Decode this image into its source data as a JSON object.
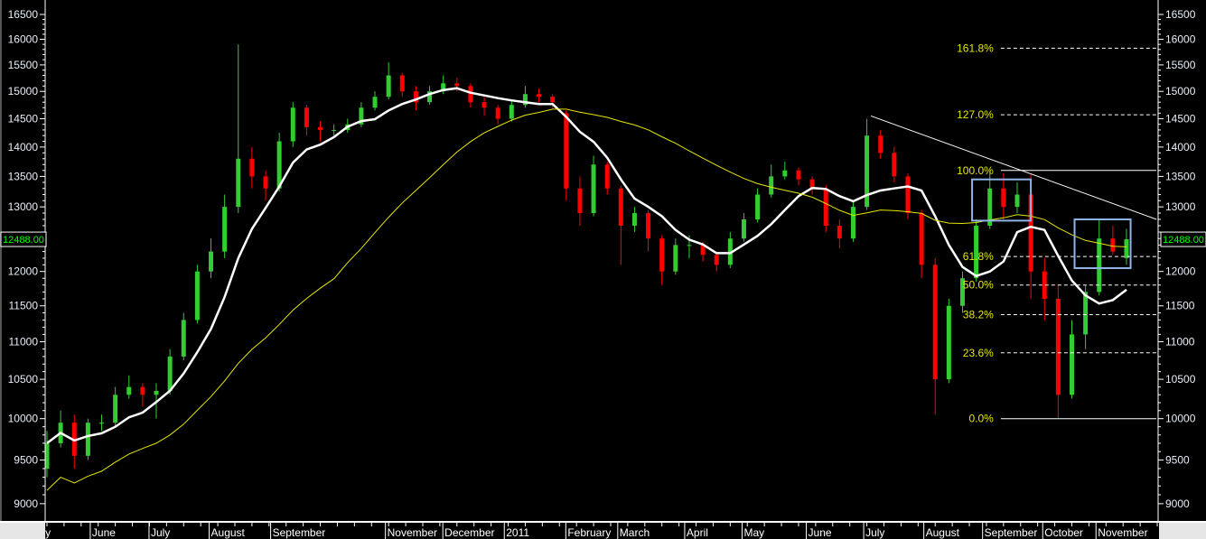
{
  "chart_data": {
    "type": "candlestick",
    "title": "",
    "ylim": [
      9000,
      16500
    ],
    "yscale": "log",
    "y_ticks": [
      16500,
      16000,
      15500,
      15000,
      14500,
      14000,
      13500,
      13000,
      12500,
      12000,
      11500,
      11000,
      10500,
      10000,
      9500,
      9000
    ],
    "last_price_label": "12488.00",
    "last_price": 12488,
    "month_labels": [
      {
        "label": "May",
        "at": -0.3
      },
      {
        "label": "June",
        "at": 3.3
      },
      {
        "label": "July",
        "at": 7.6
      },
      {
        "label": "August",
        "at": 12.0
      },
      {
        "label": "September",
        "at": 16.5
      },
      {
        "label": "November",
        "at": 24.9
      },
      {
        "label": "December",
        "at": 29.1
      },
      {
        "label": "2011",
        "at": 33.6
      },
      {
        "label": "February",
        "at": 38.1
      },
      {
        "label": "March",
        "at": 41.9
      },
      {
        "label": "April",
        "at": 46.8
      },
      {
        "label": "May",
        "at": 51.0
      },
      {
        "label": "June",
        "at": 55.7
      },
      {
        "label": "July",
        "at": 59.9
      },
      {
        "label": "August",
        "at": 64.3
      },
      {
        "label": "September",
        "at": 68.6
      },
      {
        "label": "October",
        "at": 73.0
      },
      {
        "label": "November",
        "at": 76.9
      }
    ],
    "candles": [
      [
        9400,
        9850,
        9300,
        9700
      ],
      [
        9700,
        10100,
        9650,
        9950
      ],
      [
        9950,
        10050,
        9400,
        9550
      ],
      [
        9550,
        10000,
        9500,
        9950
      ],
      [
        9950,
        10050,
        9850,
        9950
      ],
      [
        9950,
        10400,
        9900,
        10300
      ],
      [
        10300,
        10550,
        10250,
        10400
      ],
      [
        10400,
        10450,
        10150,
        10300
      ],
      [
        10300,
        10450,
        10000,
        10350
      ],
      [
        10350,
        10900,
        10300,
        10800
      ],
      [
        10800,
        11400,
        10750,
        11300
      ],
      [
        11300,
        12100,
        11250,
        12000
      ],
      [
        12000,
        12500,
        11900,
        12300
      ],
      [
        12300,
        13200,
        12200,
        13000
      ],
      [
        13000,
        15900,
        12900,
        13800
      ],
      [
        13800,
        14000,
        13300,
        13500
      ],
      [
        13500,
        13600,
        13100,
        13300
      ],
      [
        13300,
        14250,
        13250,
        14100
      ],
      [
        14100,
        14800,
        14000,
        14700
      ],
      [
        14700,
        14750,
        14200,
        14350
      ],
      [
        14350,
        14450,
        14100,
        14300
      ],
      [
        14300,
        14400,
        14200,
        14300
      ],
      [
        14300,
        14500,
        14250,
        14400
      ],
      [
        14400,
        14800,
        14350,
        14700
      ],
      [
        14700,
        15000,
        14650,
        14900
      ],
      [
        14900,
        15550,
        14850,
        15300
      ],
      [
        15300,
        15350,
        14900,
        15000
      ],
      [
        15000,
        15100,
        14650,
        14800
      ],
      [
        14800,
        15100,
        14750,
        15000
      ],
      [
        15000,
        15300,
        14950,
        15150
      ],
      [
        15150,
        15250,
        15000,
        15100
      ],
      [
        15100,
        15150,
        14700,
        14800
      ],
      [
        14800,
        14900,
        14550,
        14700
      ],
      [
        14700,
        14750,
        14400,
        14500
      ],
      [
        14500,
        14850,
        14450,
        14750
      ],
      [
        14750,
        15100,
        14700,
        14950
      ],
      [
        14950,
        15050,
        14800,
        14900
      ],
      [
        14900,
        14950,
        14700,
        14800
      ],
      [
        14600,
        14650,
        13100,
        13300
      ],
      [
        13300,
        13500,
        12700,
        12900
      ],
      [
        12900,
        13850,
        12850,
        13700
      ],
      [
        13700,
        13750,
        13200,
        13300
      ],
      [
        13300,
        13350,
        12100,
        12700
      ],
      [
        12700,
        13000,
        12600,
        12900
      ],
      [
        12900,
        12950,
        12300,
        12500
      ],
      [
        12500,
        12550,
        11800,
        12000
      ],
      [
        12000,
        12500,
        11950,
        12400
      ],
      [
        12400,
        12550,
        12200,
        12400
      ],
      [
        12400,
        12450,
        12150,
        12250
      ],
      [
        12250,
        12300,
        12000,
        12100
      ],
      [
        12100,
        12600,
        12050,
        12500
      ],
      [
        12500,
        12900,
        12450,
        12800
      ],
      [
        12800,
        13300,
        12750,
        13200
      ],
      [
        13200,
        13700,
        13150,
        13500
      ],
      [
        13500,
        13750,
        13450,
        13600
      ],
      [
        13600,
        13650,
        13350,
        13450
      ],
      [
        13450,
        13500,
        13200,
        13300
      ],
      [
        13300,
        13350,
        12600,
        12700
      ],
      [
        12700,
        12800,
        12350,
        12500
      ],
      [
        12500,
        13100,
        12450,
        13000
      ],
      [
        13000,
        14500,
        12950,
        14200
      ],
      [
        14200,
        14300,
        13800,
        13900
      ],
      [
        13900,
        14000,
        13400,
        13500
      ],
      [
        13500,
        13550,
        12800,
        12900
      ],
      [
        12900,
        12950,
        11900,
        12100
      ],
      [
        12100,
        12200,
        10050,
        10500
      ],
      [
        10500,
        11600,
        10450,
        11500
      ],
      [
        11500,
        12000,
        11400,
        11900
      ],
      [
        11900,
        12800,
        11850,
        12700
      ],
      [
        12700,
        13600,
        12650,
        13300
      ],
      [
        13300,
        13550,
        12800,
        13000
      ],
      [
        13000,
        13400,
        12900,
        13200
      ],
      [
        13200,
        13550,
        11600,
        12000
      ],
      [
        12000,
        12200,
        11300,
        11600
      ],
      [
        11600,
        11800,
        10000,
        10300
      ],
      [
        10300,
        11300,
        10250,
        11100
      ],
      [
        11100,
        11800,
        10900,
        11700
      ],
      [
        11700,
        12800,
        11650,
        12500
      ],
      [
        12500,
        12700,
        12250,
        12300
      ],
      [
        12200,
        12650,
        12100,
        12488
      ]
    ],
    "moving_averages": [
      {
        "name": "short MA",
        "period": 6,
        "color": "#ffffff"
      },
      {
        "name": "long MA",
        "period": 22,
        "color": "#e6e600"
      }
    ],
    "trendline": {
      "from": {
        "at": 60.3,
        "price": 14550
      },
      "to": {
        "at": 81.2,
        "price": 12800
      },
      "color": "#ffffff"
    },
    "fibonacci": {
      "from_at": 69.8,
      "levels": [
        {
          "label": "161.8%",
          "price": 15825,
          "style": "dashed"
        },
        {
          "label": "127.0%",
          "price": 14572,
          "style": "dashed"
        },
        {
          "label": "100.0%",
          "price": 13600,
          "style": "solid"
        },
        {
          "label": "61.8%",
          "price": 12225,
          "style": "dashed"
        },
        {
          "label": "50.0%",
          "price": 11800,
          "style": "dashed"
        },
        {
          "label": "38.2%",
          "price": 11375,
          "style": "dashed"
        },
        {
          "label": "23.6%",
          "price": 10850,
          "style": "dashed"
        },
        {
          "label": "0.0%",
          "price": 10000,
          "style": "solid"
        }
      ]
    },
    "boxes": [
      {
        "from_at": 67.7,
        "to_at": 72.0,
        "high": 13450,
        "low": 12780,
        "color": "#8fb4e8"
      },
      {
        "from_at": 75.2,
        "to_at": 79.3,
        "high": 12800,
        "low": 12050,
        "color": "#8fb4e8"
      }
    ],
    "colors": {
      "up": "#33cc33",
      "down": "#ff0000",
      "axis": "#ffffff",
      "price_box": "#00ff00"
    }
  }
}
